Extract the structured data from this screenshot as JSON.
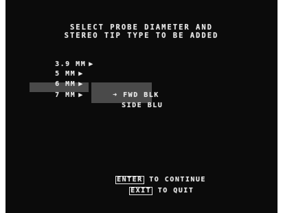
{
  "title": {
    "line1": "SELECT PROBE DIAMETER AND",
    "line2": "STEREO TIP TYPE TO BE ADDED"
  },
  "diameters": [
    {
      "label": "3.9 MM",
      "arrow": "▶"
    },
    {
      "label": "5 MM",
      "arrow": "▶"
    },
    {
      "label": "6 MM",
      "arrow": "▶"
    },
    {
      "label": "7 MM",
      "arrow": "▶",
      "selected": true
    }
  ],
  "tip_types": [
    {
      "pointer": "➜",
      "label": "FWD BLK",
      "selected": true
    },
    {
      "label": "SIDE BLU"
    }
  ],
  "footer": {
    "enter_key": "ENTER",
    "enter_text": " TO CONTINUE",
    "exit_key": "EXIT",
    "exit_text": " TO QUIT"
  },
  "colors": {
    "background": "#0b0b0b",
    "text": "#e9e9e9",
    "highlight": "#4a4a4a"
  }
}
